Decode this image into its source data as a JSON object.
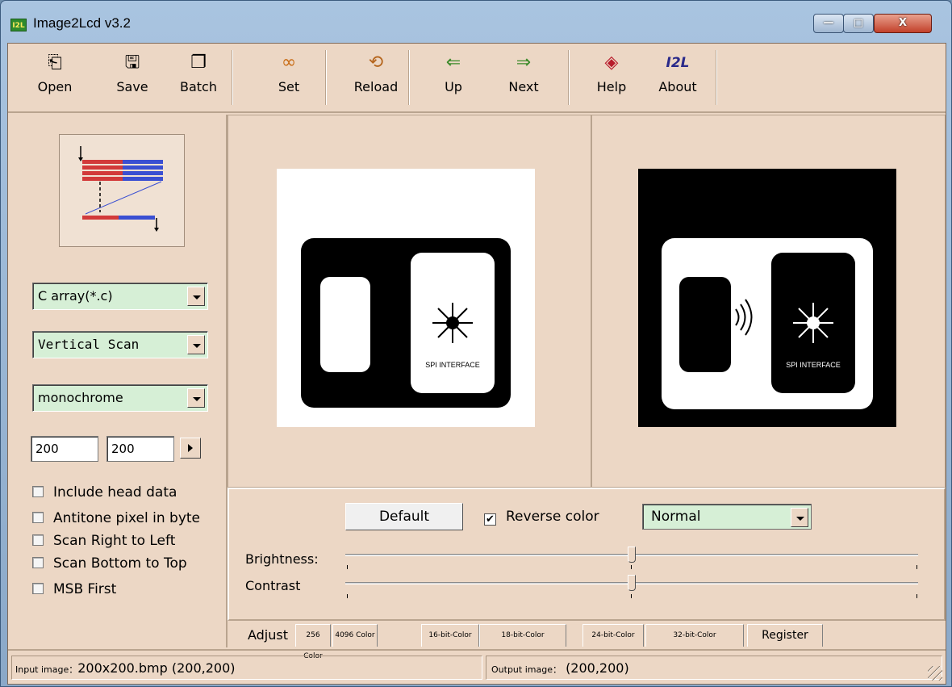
{
  "window": {
    "title": "Image2Lcd v3.2",
    "app_icon_text": "I2L",
    "minimize": "—",
    "maximize": "□",
    "close": "X"
  },
  "toolbar": {
    "items": [
      {
        "label": "Open",
        "icon": "open-folder-icon",
        "glyph": "⎗"
      },
      {
        "label": "Save",
        "icon": "save-disk-icon",
        "glyph": "🖫"
      },
      {
        "label": "Batch",
        "icon": "batch-icon",
        "glyph": "❐"
      },
      {
        "label": "Set",
        "icon": "glasses-icon",
        "glyph": "∞"
      },
      {
        "label": "Reload",
        "icon": "reload-icon",
        "glyph": "⟲"
      },
      {
        "label": "Up",
        "icon": "arrow-left-icon",
        "glyph": "⇐"
      },
      {
        "label": "Next",
        "icon": "arrow-right-icon",
        "glyph": "⇒"
      },
      {
        "label": "Help",
        "icon": "help-icon",
        "glyph": "◈"
      },
      {
        "label": "About",
        "icon": "about-icon",
        "glyph": "I2L"
      }
    ]
  },
  "settings": {
    "output_type": "C array(*.c)",
    "scan_mode": "Vertical Scan",
    "color_mode": "monochrome",
    "width": "200",
    "height": "200",
    "options": [
      {
        "label": "Include head data",
        "checked": false
      },
      {
        "label": "Antitone pixel in byte",
        "checked": false
      },
      {
        "label": "Scan Right to Left",
        "checked": false
      },
      {
        "label": "Scan Bottom to Top",
        "checked": false
      },
      {
        "label": "MSB First",
        "checked": false
      }
    ]
  },
  "preview": {
    "input_caption": "SPI INTERFACE",
    "output_caption": "SPI INTERFACE"
  },
  "adjust": {
    "default_button": "Default",
    "reverse_color_label": "Reverse color",
    "reverse_color_checked": true,
    "reverse_color_mark": "✔",
    "mode": "Normal",
    "brightness_label": "Brightness:",
    "contrast_label": "Contrast",
    "brightness_level": 0.5,
    "contrast_level": 0.5
  },
  "tabs": [
    {
      "label": "Adjust",
      "active": true
    },
    {
      "label": "256 Color"
    },
    {
      "label": "4096 Color"
    },
    {
      "label": "16-bit-Color"
    },
    {
      "label": "18-bit-Color"
    },
    {
      "label": "24-bit-Color"
    },
    {
      "label": "32-bit-Color"
    },
    {
      "label": "Register"
    }
  ],
  "status": {
    "input_key": "Input image：",
    "input_value": "200x200.bmp (200,200)",
    "output_key": "Output image：",
    "output_value": "(200,200)"
  },
  "colors": {
    "client_bg": "#ecd7c5",
    "combo_bg": "#d6efd6",
    "scan_red": "#d23a3a",
    "scan_blue": "#3a4fd2"
  }
}
